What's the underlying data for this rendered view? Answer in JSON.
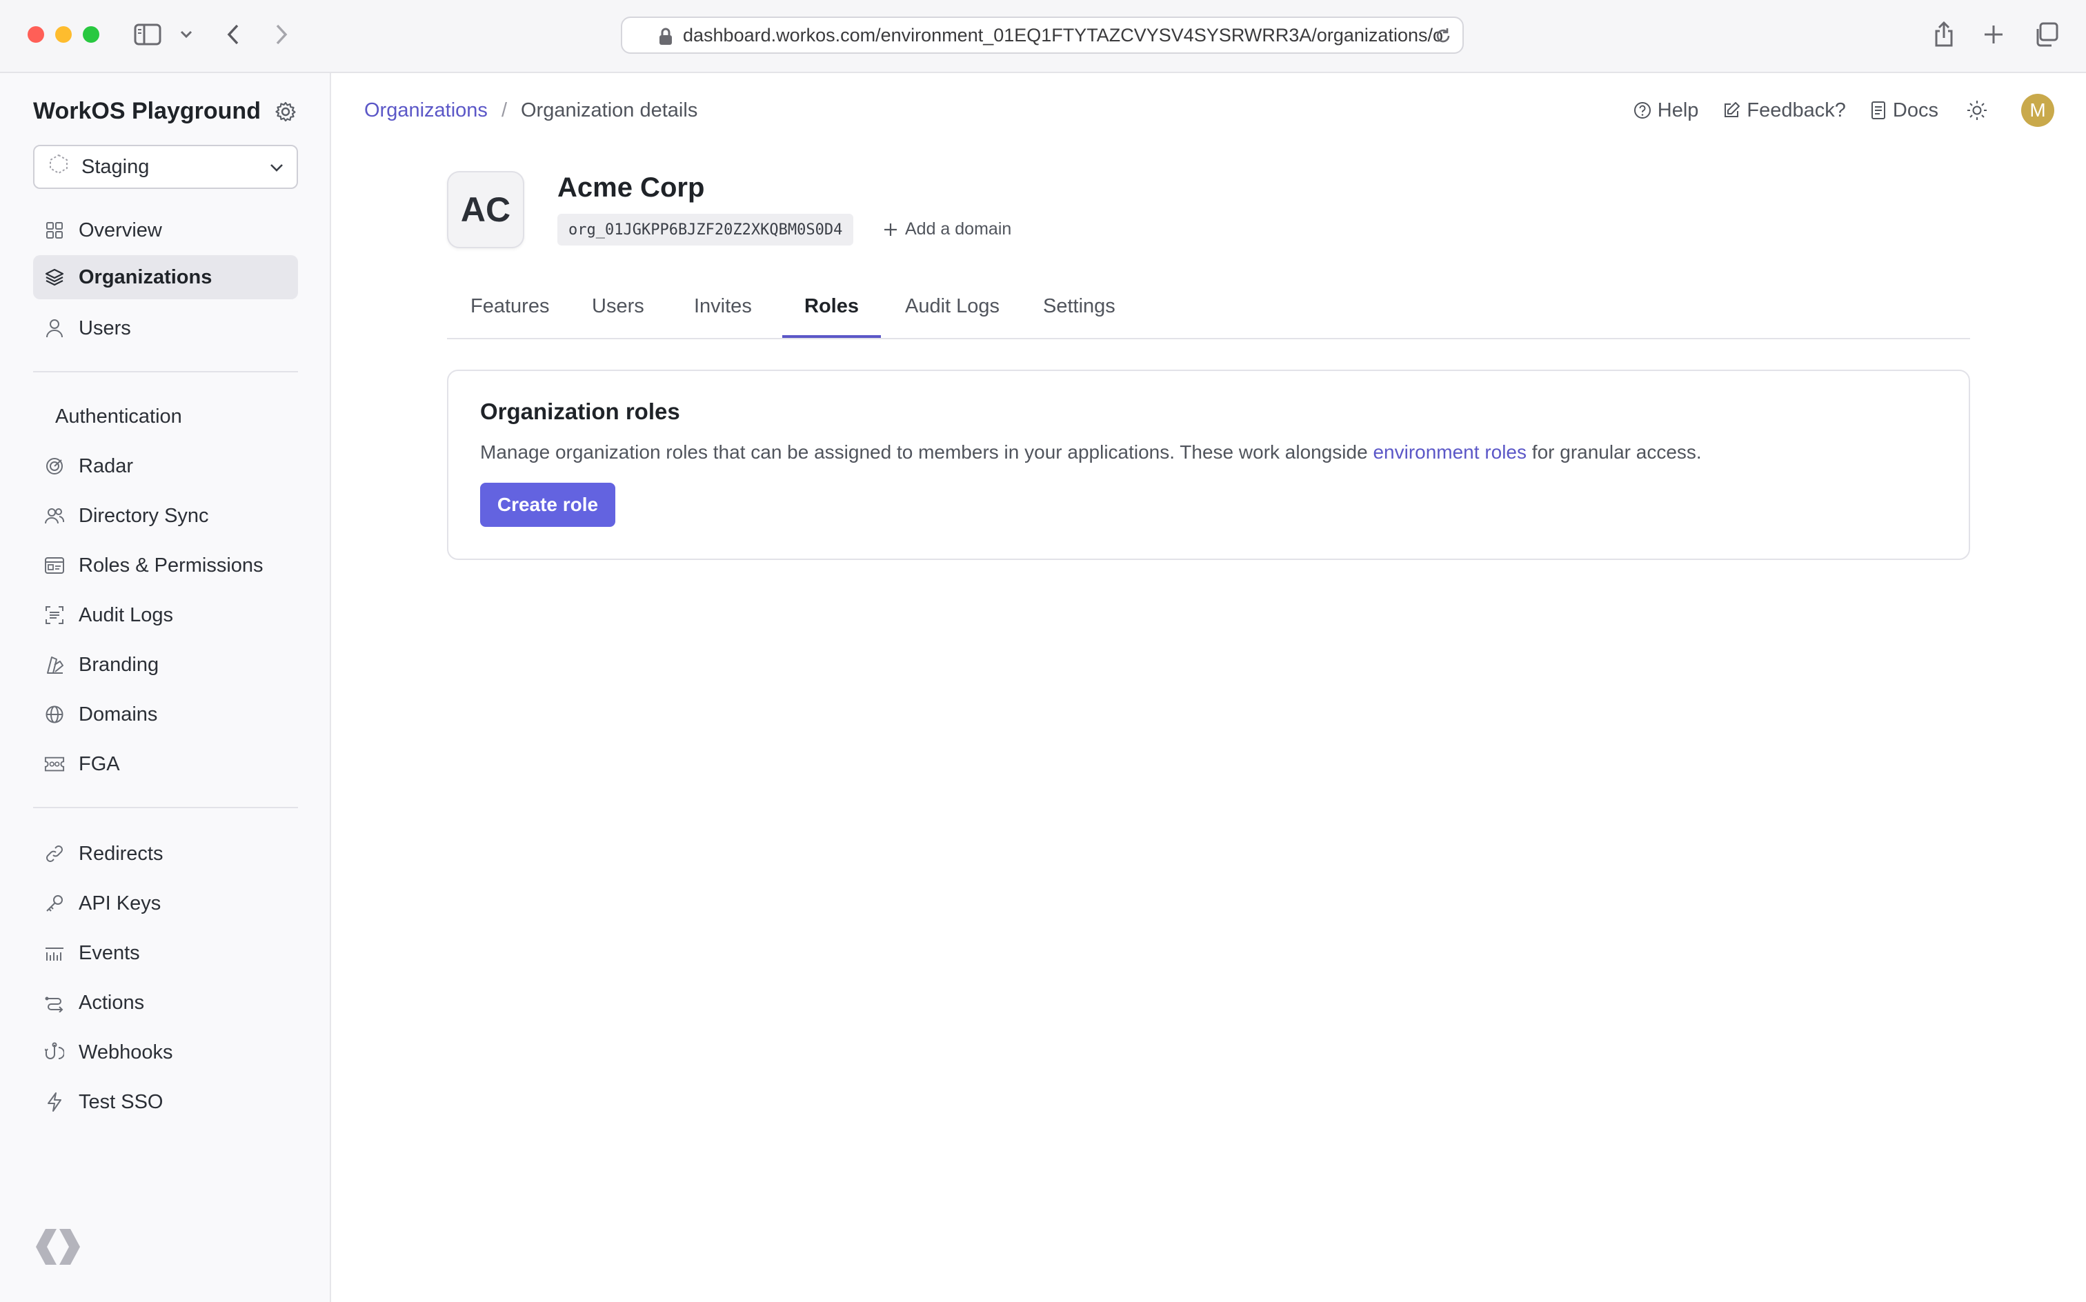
{
  "browser": {
    "url": "dashboard.workos.com/environment_01EQ1FTYTAZCVYSV4SYSRWRR3A/organizations/o"
  },
  "sidebar": {
    "workspace": "WorkOS Playground",
    "environment": "Staging",
    "primary": [
      {
        "label": "Overview",
        "icon": "grid-icon"
      },
      {
        "label": "Organizations",
        "icon": "layers-icon",
        "active": true
      },
      {
        "label": "Users",
        "icon": "user-icon"
      }
    ],
    "section_title": "Authentication",
    "auth_items": [
      {
        "label": "Radar",
        "icon": "radar-icon"
      },
      {
        "label": "Directory Sync",
        "icon": "users-icon"
      },
      {
        "label": "Roles & Permissions",
        "icon": "id-card-icon"
      },
      {
        "label": "Audit Logs",
        "icon": "scan-icon"
      },
      {
        "label": "Branding",
        "icon": "palette-icon"
      },
      {
        "label": "Domains",
        "icon": "globe-icon"
      },
      {
        "label": "FGA",
        "icon": "ticket-icon"
      }
    ],
    "dev_items": [
      {
        "label": "Redirects",
        "icon": "link-icon"
      },
      {
        "label": "API Keys",
        "icon": "key-icon"
      },
      {
        "label": "Events",
        "icon": "events-icon"
      },
      {
        "label": "Actions",
        "icon": "actions-icon"
      },
      {
        "label": "Webhooks",
        "icon": "webhook-icon"
      },
      {
        "label": "Test SSO",
        "icon": "bolt-icon"
      }
    ]
  },
  "header": {
    "breadcrumb_link": "Organizations",
    "breadcrumb_separator": "/",
    "breadcrumb_current": "Organization details",
    "help": "Help",
    "feedback": "Feedback?",
    "docs": "Docs",
    "avatar_initial": "M"
  },
  "org": {
    "initials": "AC",
    "name": "Acme Corp",
    "id": "org_01JGKPP6BJZF20Z2XKQBM0S0D4",
    "add_domain": "Add a domain"
  },
  "tabs": [
    {
      "label": "Features"
    },
    {
      "label": "Users"
    },
    {
      "label": "Invites"
    },
    {
      "label": "Roles",
      "active": true
    },
    {
      "label": "Audit Logs"
    },
    {
      "label": "Settings"
    }
  ],
  "roles_card": {
    "title": "Organization roles",
    "desc_before": "Manage organization roles that can be assigned to members in your applications. These work alongside ",
    "desc_link": "environment roles",
    "desc_after": " for granular access.",
    "button": "Create role"
  },
  "colors": {
    "accent": "#5b57c7",
    "button": "#6363e0"
  }
}
